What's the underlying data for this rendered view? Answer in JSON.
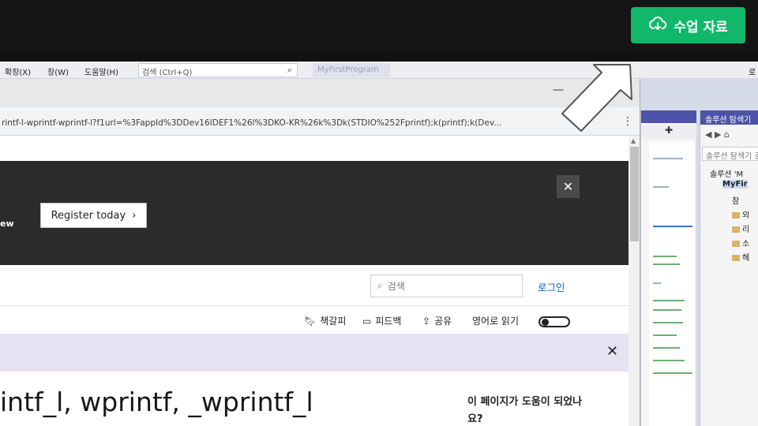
{
  "topbar": {
    "materials_button": "수업 자료",
    "materials_icon": "cloud-download-icon",
    "accent_color": "#12b86a"
  },
  "vs": {
    "menu": [
      "확장(X)",
      "창(W)",
      "도움말(H)"
    ],
    "search_placeholder": "검색 (Ctrl+Q)",
    "project_name": "MyFirstProgram",
    "right_letter": "로"
  },
  "browser": {
    "url": "rintf-l-wprintf-wprintf-l?f1url=%3FappId%3DDev16IDEF1%26l%3DKO-KR%26k%3Dk(STDIO%252Fprintf);k(printf);k(Dev...",
    "minimize": "—",
    "more": "⋮"
  },
  "page": {
    "banner_text": "ew",
    "register_button": "Register today",
    "close_glyph": "✕",
    "search_placeholder": "검색",
    "login": "로그인",
    "actions": {
      "bookmark": "책갈피",
      "feedback": "피드백",
      "share": "공유",
      "read_english": "영어로 읽기"
    },
    "title": "intf_l, wprintf, _wprintf_l",
    "helpful_question": "이 페이지가 도움이 되었나요?"
  },
  "solution_explorer": {
    "header": "솔루션 탐색기",
    "search": "솔루션 탐색기 검",
    "items": [
      "솔루션 'M",
      "MyFir",
      "참",
      "외",
      "리",
      "소",
      "헤"
    ]
  }
}
